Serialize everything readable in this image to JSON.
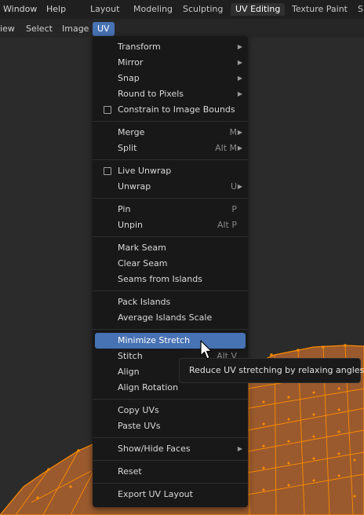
{
  "topbar": {
    "menus": [
      "Window",
      "Help"
    ],
    "workspaces": [
      "Layout",
      "Modeling",
      "Sculpting",
      "UV Editing",
      "Texture Paint",
      "S"
    ],
    "active_workspace": "UV Editing"
  },
  "editor_header": {
    "menus": [
      "iew",
      "Select",
      "Image",
      "UV"
    ],
    "active_menu": "UV"
  },
  "uv_menu": {
    "groups": [
      [
        {
          "label": "Transform",
          "shortcut": "",
          "submenu": true
        },
        {
          "label": "Mirror",
          "shortcut": "",
          "submenu": true
        },
        {
          "label": "Snap",
          "shortcut": "",
          "submenu": true
        },
        {
          "label": "Round to Pixels",
          "shortcut": "",
          "submenu": true
        },
        {
          "label": "Constrain to Image Bounds",
          "checkbox": true,
          "checked": false
        }
      ],
      [
        {
          "label": "Merge",
          "shortcut": "M",
          "submenu": true
        },
        {
          "label": "Split",
          "shortcut": "Alt M",
          "submenu": true
        }
      ],
      [
        {
          "label": "Live Unwrap",
          "checkbox": true,
          "checked": false
        },
        {
          "label": "Unwrap",
          "shortcut": "U",
          "submenu": true
        }
      ],
      [
        {
          "label": "Pin",
          "shortcut": "P"
        },
        {
          "label": "Unpin",
          "shortcut": "Alt P"
        }
      ],
      [
        {
          "label": "Mark Seam"
        },
        {
          "label": "Clear Seam"
        },
        {
          "label": "Seams from Islands"
        }
      ],
      [
        {
          "label": "Pack Islands"
        },
        {
          "label": "Average Islands Scale"
        }
      ],
      [
        {
          "label": "Minimize Stretch",
          "highlighted": true
        },
        {
          "label": "Stitch",
          "shortcut": "Alt V"
        },
        {
          "label": "Align"
        },
        {
          "label": "Align Rotation"
        }
      ],
      [
        {
          "label": "Copy UVs"
        },
        {
          "label": "Paste UVs"
        }
      ],
      [
        {
          "label": "Show/Hide Faces",
          "submenu": true
        }
      ],
      [
        {
          "label": "Reset"
        }
      ],
      [
        {
          "label": "Export UV Layout"
        }
      ]
    ]
  },
  "tooltip": {
    "text": "Reduce UV stretching by relaxing angles."
  },
  "colors": {
    "accent": "#4772b3",
    "mesh_face": "#9a5a2e",
    "mesh_edge": "#ff8c00",
    "menu_bg": "#181818"
  }
}
